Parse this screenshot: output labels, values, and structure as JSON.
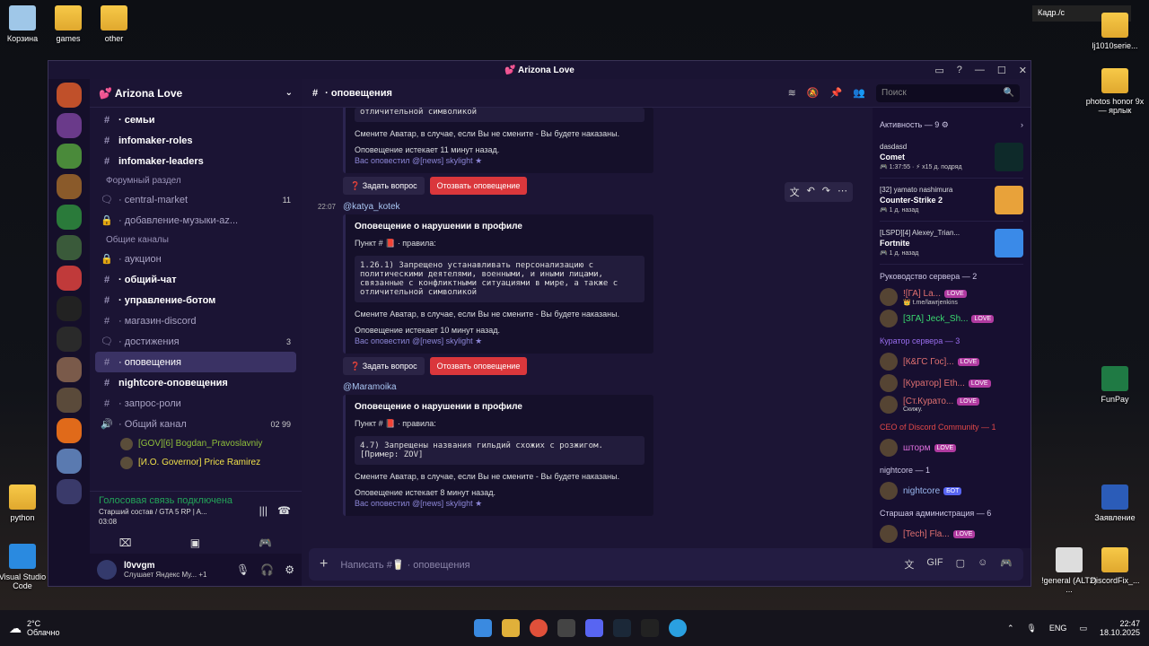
{
  "desktop": {
    "icons_left": [
      {
        "label": "Корзина"
      },
      {
        "label": "games"
      },
      {
        "label": "other"
      },
      {
        "label": "python"
      },
      {
        "label": "Visual Studio Code"
      }
    ],
    "icons_right": [
      {
        "label": "lj1010serie..."
      },
      {
        "label": "photos honor 9x — ярлык"
      },
      {
        "label": "FunPay"
      },
      {
        "label": "Заявление"
      },
      {
        "label": "!general (ALT2) ..."
      },
      {
        "label": "DiscordFix_..."
      }
    ],
    "top_right_bar": "Кадр./с"
  },
  "window": {
    "title": "💕 Arizona Love",
    "controls": [
      "▭",
      "?",
      "—",
      "☐",
      "✕"
    ]
  },
  "guild": {
    "name": "💕 Arizona Love"
  },
  "channels": [
    {
      "icon": "#",
      "label": "· семьи",
      "bold": true
    },
    {
      "icon": "#",
      "label": "infomaker-roles",
      "bold": true
    },
    {
      "icon": "#",
      "label": "infomaker-leaders",
      "bold": true
    },
    {
      "type": "category",
      "label": "Форумный раздел"
    },
    {
      "icon": "🗨",
      "label": "· central-market",
      "count": "11"
    },
    {
      "icon": "🔒",
      "label": "· добавление-музыки-az..."
    },
    {
      "type": "category",
      "label": "Общие каналы"
    },
    {
      "icon": "🔒",
      "label": "· аукцион"
    },
    {
      "icon": "#",
      "label": "· общий-чат",
      "bold": true
    },
    {
      "icon": "#",
      "label": "· управление-ботом",
      "bold": true
    },
    {
      "icon": "#",
      "label": "· магазин-discord"
    },
    {
      "icon": "🗨",
      "label": "· достижения",
      "count": "3"
    },
    {
      "icon": "#",
      "label": "· оповещения",
      "active": true
    },
    {
      "icon": "#",
      "label": "nightcore-оповещения",
      "bold": true
    },
    {
      "icon": "#",
      "label": "· запрос-роли"
    },
    {
      "icon": "🔊",
      "label": "· Общий канал",
      "count": "02 99"
    }
  ],
  "voice_users": [
    {
      "name": "[GOV][6] Bogdan_Pravoslavniy",
      "color": "#8fbf3a"
    },
    {
      "name": "[И.О. Governor] Price Ramirez",
      "color": "#f0e04a"
    }
  ],
  "voice": {
    "status": "Голосовая связь подключена",
    "sub": "Старший состав / GTA 5 RP | A...",
    "time": "03:08"
  },
  "user": {
    "name": "l0vvgm",
    "status": "Слушает Яндекс Му... +1"
  },
  "channel_header": {
    "name": "· оповещения",
    "search_placeholder": "Поиск"
  },
  "messages": [
    {
      "partial": true,
      "code_tail": "отличительной символикой",
      "line1": "Смените Аватар, в случае, если Вы не смените - Вы будете наказаны.",
      "expires": "Оповещение истекает 11 минут назад.",
      "notified": "Вас оповестил @[news] skylight ★"
    },
    {
      "time": "22:07",
      "author": "@katya_kotek",
      "title": "Оповещение о нарушении в профиле",
      "rule": "Пункт # 📕 · правила:",
      "code": "1.26.1) Запрещено устанавливать персонализацию с политическими деятелями, военными, и иными лицами, связанные с конфликтными ситуациями в мире, а также с отличительной символикой",
      "line1": "Смените Аватар, в случае, если Вы не смените - Вы будете наказаны.",
      "expires": "Оповещение истекает 10 минут назад.",
      "notified": "Вас оповестил @[news] skylight ★"
    },
    {
      "time": "",
      "author": "@Maramoika",
      "title": "Оповещение о нарушении в профиле",
      "rule": "Пункт # 📕 · правила:",
      "code": "4.7) Запрещены названия гильдий схожих с розжигом. [Пример: ZOV]",
      "line1": "Смените Аватар, в случае, если Вы не смените - Вы будете наказаны.",
      "expires": "Оповещение истекает 8 минут назад.",
      "notified": "Вас оповестил @[news] skylight ★"
    }
  ],
  "buttons": {
    "ask": "❓ Задать вопрос",
    "revoke": "Отозвать оповещение"
  },
  "composer": {
    "placeholder": "Написать #🥛 · оповещения"
  },
  "members": {
    "activity_header": "Активность — 9 ⚙",
    "activities": [
      {
        "user": "dasdasd",
        "game": "Comet",
        "sub": "🎮 1:37:55 · ⚡ x15 д. подряд",
        "color": "#0e2a2a"
      },
      {
        "user": "[32] yamato nashimura",
        "game": "Counter-Strike 2",
        "sub": "🎮 1 д. назад",
        "color": "#e8a23a"
      },
      {
        "user": "[LSPD][4] Alexey_Trian...",
        "game": "Fortnite",
        "sub": "🎮 1 д. назад",
        "color": "#3a8ae8"
      }
    ],
    "groups": [
      {
        "header": "Руководство сервера — 2",
        "color": "#cfc9e8",
        "items": [
          {
            "name": "![ГА] La...",
            "color": "#e07070",
            "badge": "LOVE",
            "sub": "👑 t.me/lawrjenkins"
          },
          {
            "name": "[ЗГА] Jeck_Sh...",
            "color": "#3ad870",
            "badge": "LOVE",
            "sub": ""
          }
        ]
      },
      {
        "header": "Куратор сервера — 3",
        "color": "#9a6ef0",
        "items": [
          {
            "name": "[К&ГС Гос]...",
            "color": "#e07070",
            "badge": "LOVE",
            "sub": ""
          },
          {
            "name": "[Куратор] Eth...",
            "color": "#e07070",
            "badge": "LOVE",
            "sub": ""
          },
          {
            "name": "[Ст.Курато...",
            "color": "#e07070",
            "badge": "LOVE",
            "sub": "Скижу."
          }
        ]
      },
      {
        "header": "CEO of Discord Community — 1",
        "color": "#e04848",
        "items": [
          {
            "name": "шторм",
            "color": "#e070e0",
            "badge": "LOVE",
            "sub": ""
          }
        ]
      },
      {
        "header": "nightcore — 1",
        "color": "#cfc9e8",
        "items": [
          {
            "name": "nightcore",
            "color": "#9ab8f0",
            "badge": "БОТ",
            "sub": ""
          }
        ]
      },
      {
        "header": "Старшая администрация — 6",
        "color": "#cfc9e8",
        "items": [
          {
            "name": "[Tech] Fla...",
            "color": "#e07070",
            "badge": "LOVE",
            "sub": ""
          }
        ]
      }
    ]
  },
  "taskbar": {
    "weather_temp": "2°C",
    "weather_text": "Облачно",
    "lang": "ENG",
    "time": "22:47",
    "date": "18.10.2025"
  }
}
